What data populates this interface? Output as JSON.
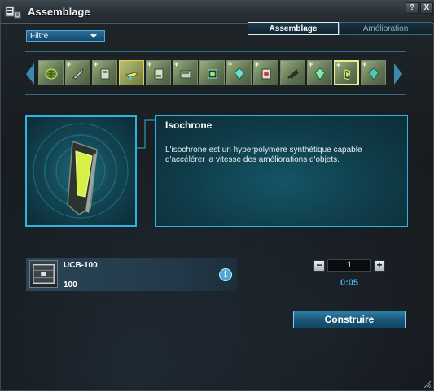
{
  "window": {
    "title": "Assemblage",
    "help_label": "?",
    "close_label": "X"
  },
  "filter": {
    "label": "Filtre"
  },
  "tabs": [
    {
      "label": "Assemblage",
      "active": true
    },
    {
      "label": "Amélioration",
      "active": false
    }
  ],
  "items": [
    {
      "icon": "mesh-disc-icon",
      "plus": "",
      "color": "#7ea04a"
    },
    {
      "icon": "wrench-icon",
      "plus": "+",
      "color": "#9aa58a"
    },
    {
      "icon": "armor-plate-icon",
      "plus": "+",
      "color": "#8aa088"
    },
    {
      "icon": "blaster-icon",
      "plus": "",
      "color": "#c9c24a"
    },
    {
      "icon": "armor-plate-icon",
      "plus": "+",
      "color": "#8aa088"
    },
    {
      "icon": "shield-module-icon",
      "plus": "+",
      "color": "#7c9a84"
    },
    {
      "icon": "chip-icon",
      "plus": "",
      "color": "#59a7a8"
    },
    {
      "icon": "gem-icon",
      "plus": "+",
      "color": "#4db7a3"
    },
    {
      "icon": "red-core-icon",
      "plus": "+",
      "color": "#c0504a"
    },
    {
      "icon": "antenna-icon",
      "plus": "",
      "color": "#6f8c6a"
    },
    {
      "icon": "gem-icon",
      "plus": "+",
      "color": "#4db7a3"
    },
    {
      "icon": "isochrone-icon",
      "plus": "+",
      "color": "#d7e66a"
    },
    {
      "icon": "gem-icon",
      "plus": "+",
      "color": "#57c6b0"
    }
  ],
  "selected_item": {
    "name": "Isochrone",
    "description": "L'isochrone est un hyperpolymère synthétique capable d'accélérer la vitesse des améliorations d'objets."
  },
  "material": {
    "name": "UCB-100",
    "quantity": "100",
    "icon": "crate-icon",
    "info_label": "i"
  },
  "stepper": {
    "minus_label": "−",
    "value": "1",
    "plus_label": "+"
  },
  "timer": "0:05",
  "build_button": "Construire",
  "colors": {
    "accent": "#2fb5d9",
    "timer": "#39b6e6",
    "highlight": "#e4d24a"
  }
}
